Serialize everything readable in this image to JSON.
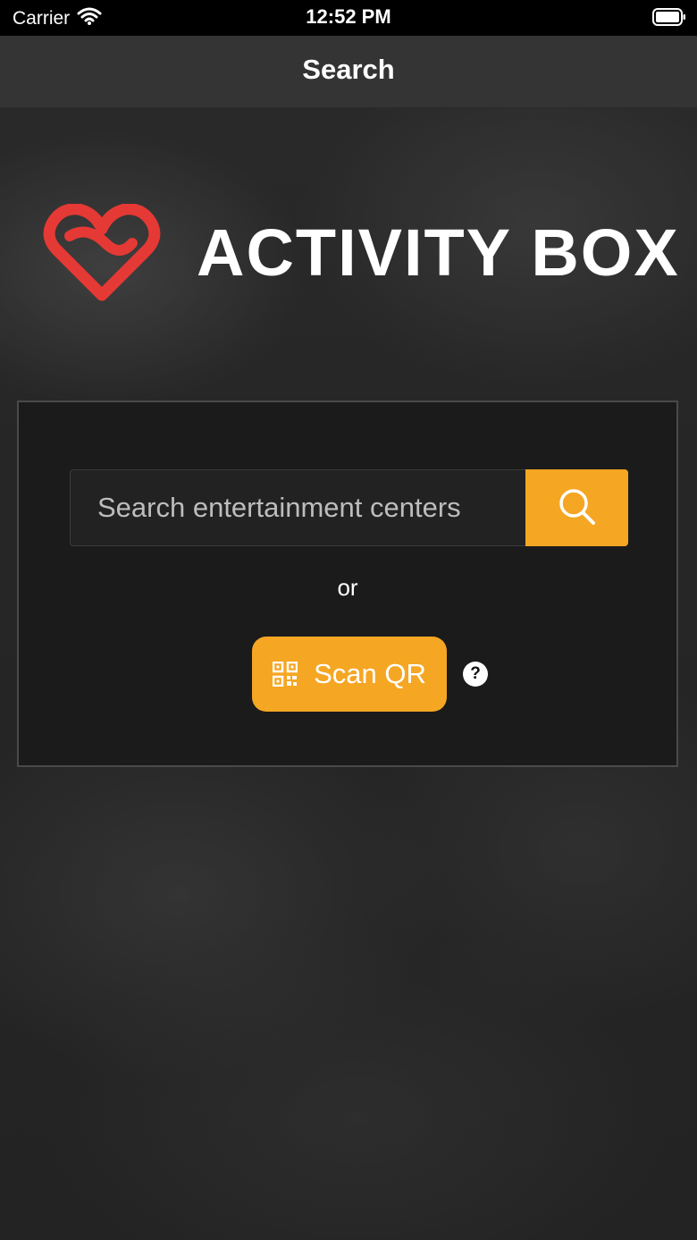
{
  "status_bar": {
    "carrier": "Carrier",
    "time": "12:52 PM"
  },
  "nav": {
    "title": "Search"
  },
  "logo": {
    "text": "ACTIVITY BOX",
    "heart_color": "#e53935"
  },
  "search": {
    "placeholder": "Search entertainment centers",
    "value": "",
    "button_icon": "search-icon"
  },
  "divider_text": "or",
  "scan_button": {
    "label": "Scan QR",
    "icon": "qr-code-icon"
  },
  "help": {
    "symbol": "?"
  },
  "colors": {
    "accent": "#f5a623",
    "panel_bg": "#1b1b1b",
    "nav_bg": "#343434"
  }
}
